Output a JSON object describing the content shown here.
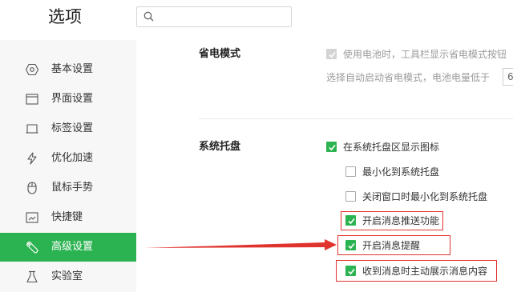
{
  "header": {
    "title": "选项",
    "search": {
      "value": "",
      "placeholder": ""
    }
  },
  "sidebar": {
    "items": [
      {
        "label": "基本设置",
        "icon": "hexagon-settings-icon",
        "active": false
      },
      {
        "label": "界面设置",
        "icon": "window-icon",
        "active": false
      },
      {
        "label": "标签设置",
        "icon": "tab-icon",
        "active": false
      },
      {
        "label": "优化加速",
        "icon": "lightning-icon",
        "active": false
      },
      {
        "label": "鼠标手势",
        "icon": "mouse-icon",
        "active": false
      },
      {
        "label": "快捷键",
        "icon": "keyboard-shortcut-icon",
        "active": false
      },
      {
        "label": "高级设置",
        "icon": "wrench-icon",
        "active": true
      },
      {
        "label": "实验室",
        "icon": "flask-icon",
        "active": false
      }
    ]
  },
  "main": {
    "power_saving": {
      "title": "省电模式",
      "battery_toolbar": {
        "label": "使用电池时，工具栏显示省电模式按钮",
        "checked": true,
        "disabled": true
      },
      "auto_enable": {
        "label": "选择自动启动省电模式，电池电量低于",
        "value": "6"
      }
    },
    "system_tray": {
      "title": "系统托盘",
      "options": [
        {
          "label": "在系统托盘区显示图标",
          "checked": true,
          "highlighted": false
        },
        {
          "label": "最小化到系统托盘",
          "checked": false,
          "highlighted": false
        },
        {
          "label": "关闭窗口时最小化到系统托盘",
          "checked": false,
          "highlighted": false
        },
        {
          "label": "开启消息推送功能",
          "checked": true,
          "highlighted": true
        },
        {
          "label": "开启消息提醒",
          "checked": true,
          "highlighted": true
        },
        {
          "label": "收到消息时主动展示消息内容",
          "checked": true,
          "highlighted": true
        }
      ]
    }
  },
  "colors": {
    "accent": "#2cb351",
    "highlight_box": "#e0332e",
    "sidebar_bg": "#f7f7f7"
  }
}
